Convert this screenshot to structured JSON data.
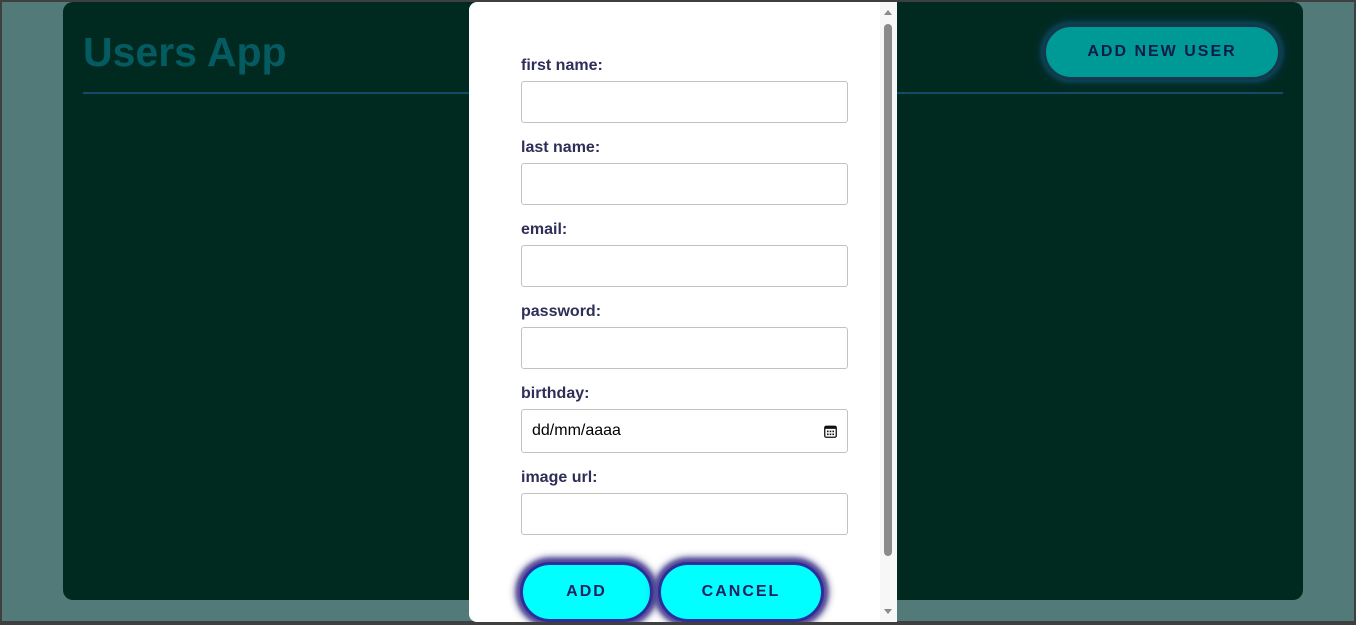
{
  "app": {
    "title": "Users App",
    "add_new_user_label": "ADD NEW USER"
  },
  "form": {
    "fields": [
      {
        "label": "first name:",
        "value": ""
      },
      {
        "label": "last name:",
        "value": ""
      },
      {
        "label": "email:",
        "value": ""
      },
      {
        "label": "password:",
        "value": ""
      },
      {
        "label": "birthday:",
        "placeholder": "dd/mm/aaaa"
      },
      {
        "label": "image url:",
        "value": ""
      }
    ],
    "add_label": "ADD",
    "cancel_label": "CANCEL"
  },
  "icons": {
    "birthday_picker": "calendar-icon"
  },
  "colors": {
    "app_background": "#002a20",
    "title": "#045b62",
    "accent_button": "#00ffff",
    "header_button": "#009a96",
    "label_text": "#2e2e58"
  }
}
